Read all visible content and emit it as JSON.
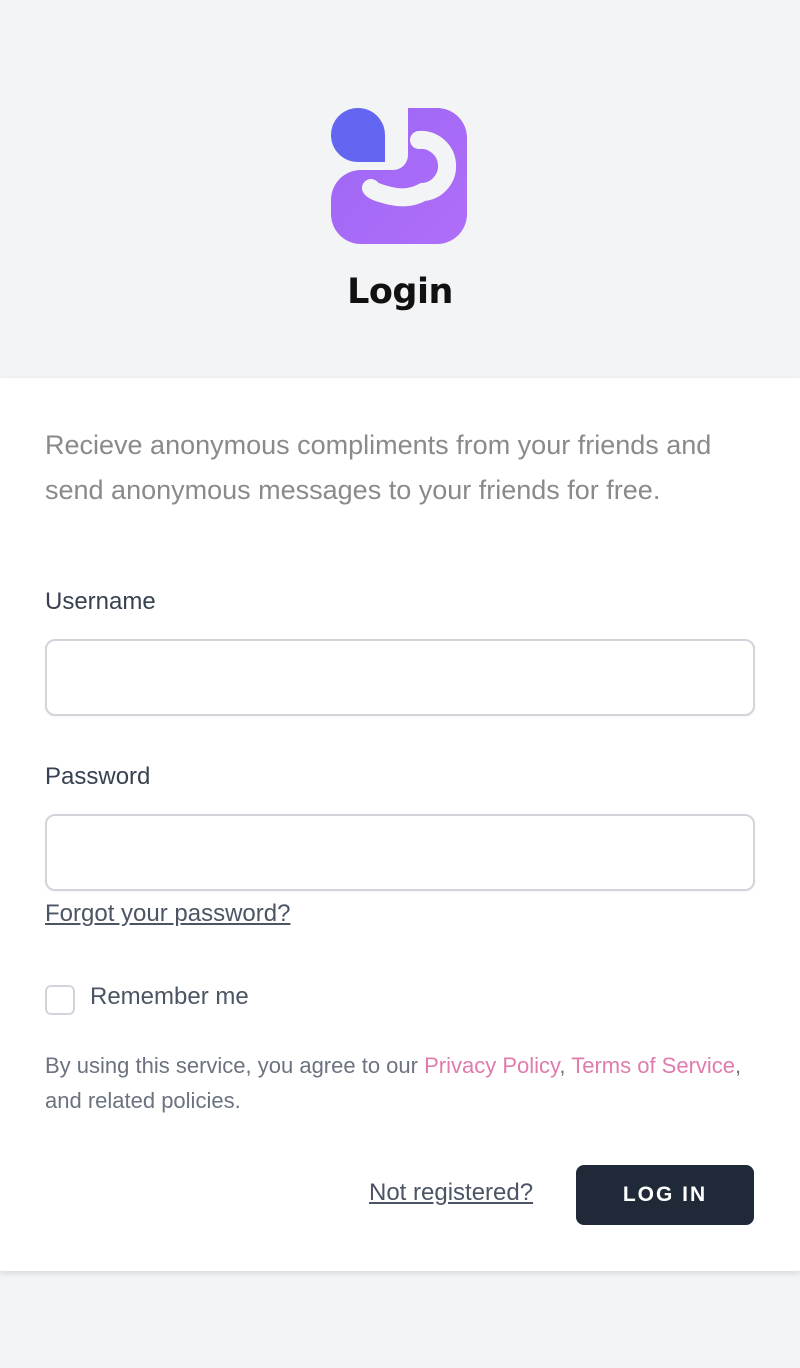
{
  "header": {
    "title": "Login"
  },
  "intro": "Recieve anonymous compliments from your friends and send anonymous messages to your friends for free.",
  "form": {
    "username_label": "Username",
    "username_value": "",
    "password_label": "Password",
    "password_value": "",
    "forgot_link": "Forgot your password?",
    "remember_label": "Remember me",
    "remember_checked": false
  },
  "terms": {
    "prefix": "By using this service, you agree to our ",
    "privacy": "Privacy Policy",
    "sep": ", ",
    "terms_link": "Terms of Service",
    "suffix": ", and related policies."
  },
  "actions": {
    "not_registered": "Not registered?",
    "login_button": "LOG IN"
  },
  "colors": {
    "logo_dot": "#6366f1",
    "logo_body": "#a86ef7",
    "accent_link": "#e07bae",
    "button_bg": "#1f2937"
  },
  "icons": {
    "logo": "app-logo-icon"
  }
}
